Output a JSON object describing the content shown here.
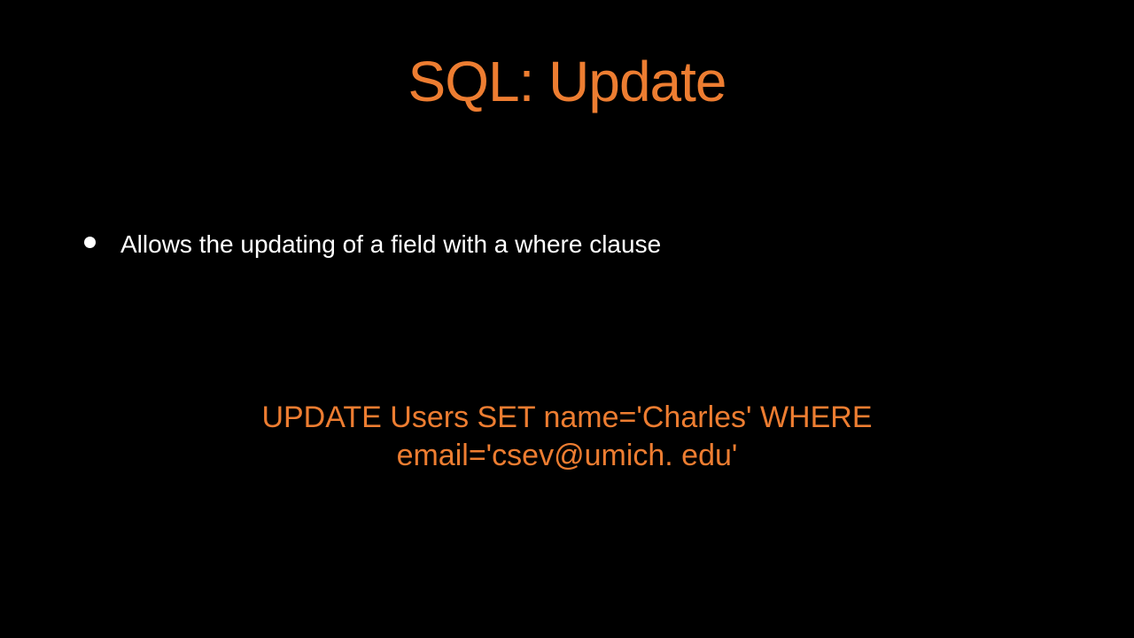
{
  "slide": {
    "title": "SQL: Update",
    "bullet": "Allows the updating of a field with a where clause",
    "code_line1": "UPDATE Users SET name='Charles' WHERE",
    "code_line2": "email='csev@umich. edu'"
  },
  "colors": {
    "background": "#000000",
    "accent": "#ed7d31",
    "text": "#ffffff"
  }
}
